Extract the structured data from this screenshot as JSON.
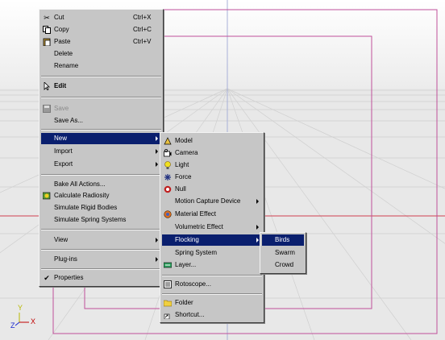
{
  "viewport": {
    "axis_y": "Y",
    "axis_x": "X",
    "axis_z": "Z"
  },
  "menu1": {
    "items": [
      {
        "label": "Cut",
        "shortcut": "Ctrl+X",
        "icon": "scissors-icon"
      },
      {
        "label": "Copy",
        "shortcut": "Ctrl+C",
        "icon": "copy-icon"
      },
      {
        "label": "Paste",
        "shortcut": "Ctrl+V",
        "icon": "clipboard-icon"
      },
      {
        "label": "Delete"
      },
      {
        "label": "Rename"
      },
      {
        "label": "Edit",
        "icon": "pointer-icon",
        "bold": true
      },
      {
        "label": "Save",
        "icon": "disk-icon",
        "disabled": true
      },
      {
        "label": "Save As..."
      },
      {
        "label": "New",
        "highlighted": true,
        "submenu": true
      },
      {
        "label": "Import",
        "submenu": true
      },
      {
        "label": "Export",
        "submenu": true
      },
      {
        "label": "Bake All Actions..."
      },
      {
        "label": "Calculate Radiosity",
        "icon": "radiosity-icon"
      },
      {
        "label": "Simulate Rigid Bodies"
      },
      {
        "label": "Simulate Spring Systems"
      },
      {
        "label": "View",
        "submenu": true
      },
      {
        "label": "Plug-ins",
        "submenu": true
      },
      {
        "label": "Properties",
        "checked": true,
        "check": "✔"
      }
    ]
  },
  "menu2": {
    "items": [
      {
        "label": "Model",
        "icon": "model-icon"
      },
      {
        "label": "Camera",
        "icon": "camera-icon"
      },
      {
        "label": "Light",
        "icon": "light-icon"
      },
      {
        "label": "Force",
        "icon": "force-icon"
      },
      {
        "label": "Null",
        "icon": "null-icon"
      },
      {
        "label": "Motion Capture Device",
        "submenu": true
      },
      {
        "label": "Material Effect",
        "icon": "material-icon"
      },
      {
        "label": "Volumetric Effect",
        "submenu": true
      },
      {
        "label": "Flocking",
        "highlighted": true,
        "submenu": true
      },
      {
        "label": "Spring System"
      },
      {
        "label": "Layer...",
        "icon": "layer-icon"
      },
      {
        "label": "Rotoscope...",
        "icon": "rotoscope-icon"
      },
      {
        "label": "Folder",
        "icon": "folder-icon"
      },
      {
        "label": "Shortcut...",
        "icon": "shortcut-icon"
      }
    ]
  },
  "menu3": {
    "items": [
      {
        "label": "Birds",
        "highlighted": true
      },
      {
        "label": "Swarm"
      },
      {
        "label": "Crowd"
      }
    ]
  },
  "colors": {
    "highlight": "#0a1f6e",
    "menu_bg": "#c6c6c6",
    "frame": "#c0509a",
    "horizon": "#d04050",
    "axis_y": "#b8b800",
    "axis_x": "#c00000",
    "axis_z": "#1a2ad0"
  }
}
